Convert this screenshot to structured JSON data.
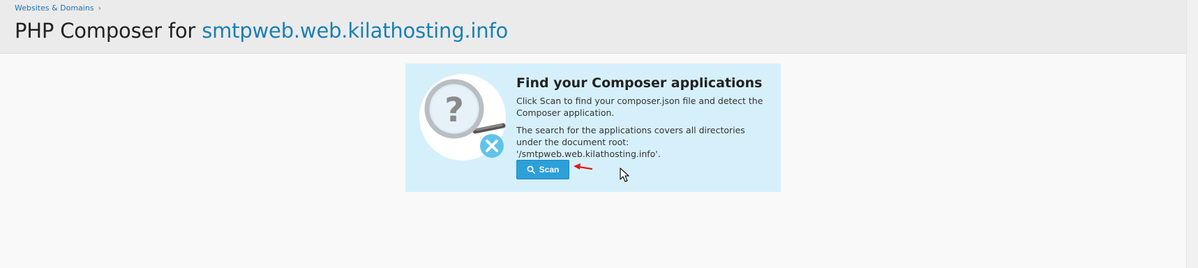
{
  "breadcrumb": {
    "items": [
      {
        "label": "Websites & Domains"
      }
    ],
    "separator": "›"
  },
  "page": {
    "title_prefix": "PHP Composer for",
    "title_domain": "smtpweb.web.kilathosting.info"
  },
  "panel": {
    "heading": "Find your Composer applications",
    "paragraph1": "Click Scan to find your composer.json file and detect the Composer application.",
    "paragraph2": "The search for the applications covers all directories under the document root: '/smtpweb.web.kilathosting.info'.",
    "scan_label": "Scan",
    "illustration_icon": "magnifier-question-icon"
  },
  "colors": {
    "link": "#1a7fb5",
    "panel_bg": "#d6f0fb",
    "button": "#2d9fd9",
    "annotation_arrow": "#e01b1b"
  }
}
